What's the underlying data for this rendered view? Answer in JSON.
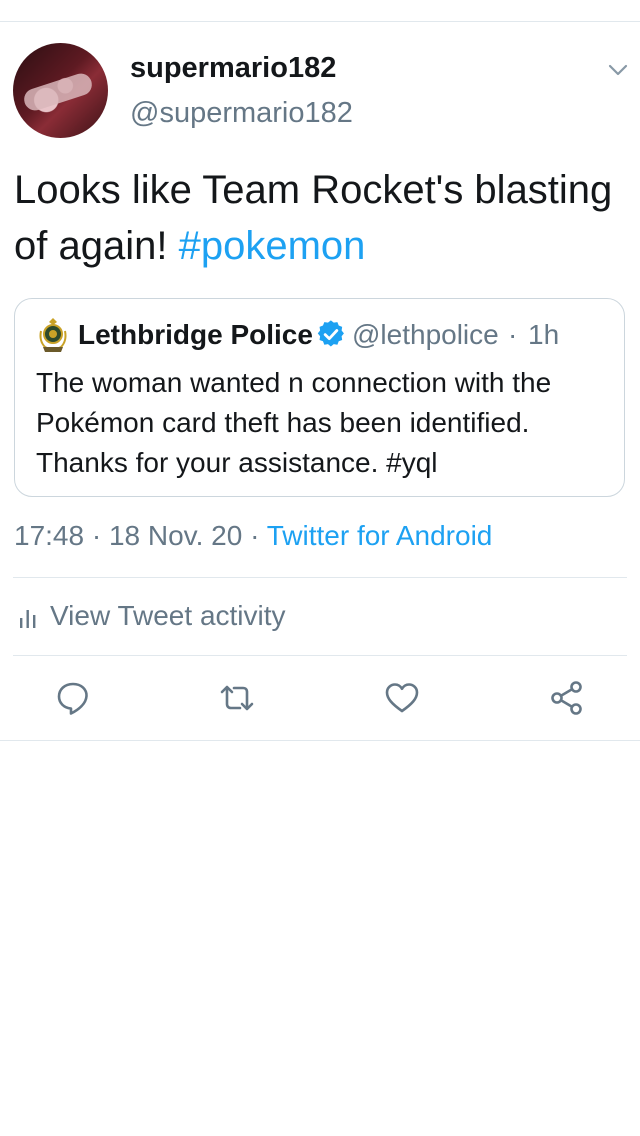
{
  "tweet": {
    "display_name": "supermario182",
    "handle": "@supermario182",
    "text_plain": "Looks like Team Rocket's blasting of again! ",
    "hashtag": "#pokemon",
    "timestamp": "17:48",
    "date": "18 Nov. 20",
    "separator": " · ",
    "client": "Twitter for Android"
  },
  "quoted_tweet": {
    "display_name": "Lethbridge Police",
    "handle": "@lethpolice",
    "separator": "·",
    "time_ago": "1h",
    "text": "The woman wanted n connection with the Pokémon card theft has been identified. Thanks for your assistance. #yql"
  },
  "activity": {
    "label": "View Tweet activity"
  },
  "icons": {
    "menu": "chevron-down-icon",
    "reply": "reply-icon",
    "retweet": "retweet-icon",
    "like": "heart-icon",
    "share": "share-icon",
    "verified": "verified-badge-icon",
    "activity": "bar-chart-icon"
  },
  "colors": {
    "accent": "#1da1f2",
    "muted": "#657786",
    "divider": "#e1e8ed",
    "text": "#14171a"
  }
}
